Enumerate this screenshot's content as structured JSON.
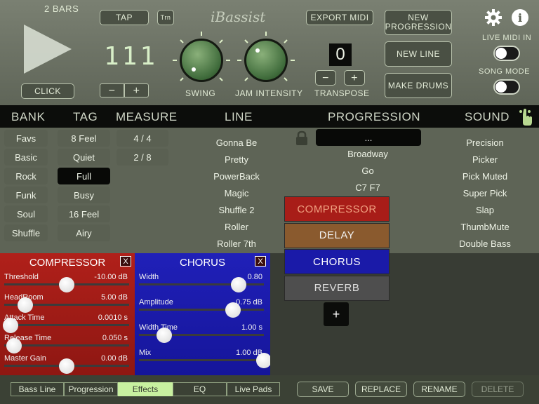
{
  "transport": {
    "bars_label": "2 BARS",
    "click_label": "CLICK"
  },
  "tempo": {
    "tap_label": "TAP",
    "trn_label": "Trn",
    "display": "111",
    "minus": "−",
    "plus": "+"
  },
  "knobs": {
    "swing_label": "SWING",
    "jam_label": "JAM INTENSITY",
    "swing_level": 0.32,
    "jam_level": 0.12
  },
  "brand": {
    "logo_text": "iBassist"
  },
  "export": {
    "label": "EXPORT MIDI"
  },
  "transpose": {
    "value": "0",
    "label": "TRANSPOSE",
    "minus": "−",
    "plus": "+"
  },
  "actions": {
    "new_progression": "NEW PROGRESSION",
    "new_line": "NEW LINE",
    "make_drums": "MAKE DRUMS"
  },
  "switches": {
    "live_midi_label": "LIVE MIDI IN",
    "song_mode_label": "SONG MODE"
  },
  "columns": {
    "bank": "BANK",
    "tag": "TAG",
    "measure": "MEASURE",
    "line": "LINE",
    "progression": "PROGRESSION",
    "sound": "SOUND"
  },
  "bank_items": [
    "Favs",
    "Basic",
    "Rock",
    "Funk",
    "Soul",
    "Shuffle"
  ],
  "tag_items": [
    "8 Feel",
    "Quiet",
    "Full",
    "Busy",
    "16 Feel",
    "Airy"
  ],
  "measure_items": [
    "4 / 4",
    "2 / 8"
  ],
  "line_items": [
    "Gonna Be",
    "Pretty",
    "PowerBack",
    "Magic",
    "Shuffle 2",
    "Roller",
    "Roller 7th"
  ],
  "progression": {
    "selected": "...",
    "items": [
      "Broadway",
      "Go",
      "C7 F7"
    ]
  },
  "sound_items": [
    "Precision",
    "Picker",
    "Pick Muted",
    "Super Pick",
    "Slap",
    "ThumbMute",
    "Double Bass"
  ],
  "compressor": {
    "title": "COMPRESSOR",
    "close": "X",
    "params": [
      {
        "name": "Threshold",
        "value": "-10.00 dB",
        "pos": 0.5
      },
      {
        "name": "HeadRoom",
        "value": "5.00 dB",
        "pos": 0.17
      },
      {
        "name": "Attack Time",
        "value": "0.0010 s",
        "pos": 0.05
      },
      {
        "name": "Release Time",
        "value": "0.050 s",
        "pos": 0.08
      },
      {
        "name": "Master Gain",
        "value": "0.00 dB",
        "pos": 0.5
      }
    ]
  },
  "chorus": {
    "title": "CHORUS",
    "close": "X",
    "params": [
      {
        "name": "Width",
        "value": "0.80",
        "pos": 0.8
      },
      {
        "name": "Amplitude",
        "value": "0.75 dB",
        "pos": 0.75
      },
      {
        "name": "Width Time",
        "value": "1.00 s",
        "pos": 0.2
      },
      {
        "name": "Mix",
        "value": "1.00 dB",
        "pos": 1.0
      }
    ]
  },
  "effects_menu": {
    "items": [
      "COMPRESSOR",
      "DELAY",
      "CHORUS",
      "REVERB"
    ],
    "add": "+"
  },
  "tabs": [
    "Bass Line",
    "Progression",
    "Effects",
    "EQ",
    "Live Pads"
  ],
  "bottom_buttons": [
    "SAVE",
    "REPLACE",
    "RENAME",
    "DELETE"
  ],
  "colors": {
    "accent_green": "#c8f0a0",
    "compressor_red": "#a81d18",
    "chorus_blue": "#1a1aa8",
    "delay_brown": "#8a5a2e",
    "reverb_gray": "#4e4e4e"
  }
}
